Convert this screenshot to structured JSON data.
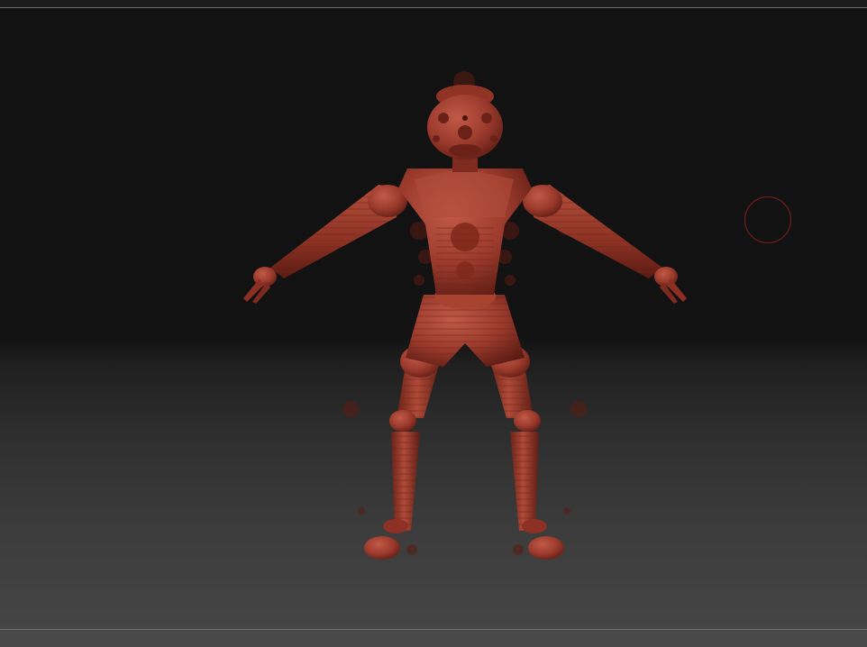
{
  "app": {
    "name": "3d-sculpting-viewport"
  },
  "viewport": {
    "background_top_color": "#121212",
    "background_bottom_color": "#454545",
    "model": {
      "name": "humanoid-mannequin",
      "material_color": "#9b3a2c",
      "highlight_color": "#c25a47",
      "shadow_color": "#5a1a12",
      "pose": "A-pose"
    },
    "brush_cursor": {
      "icon": "brush-circle-icon",
      "color": "#7d2218"
    }
  }
}
